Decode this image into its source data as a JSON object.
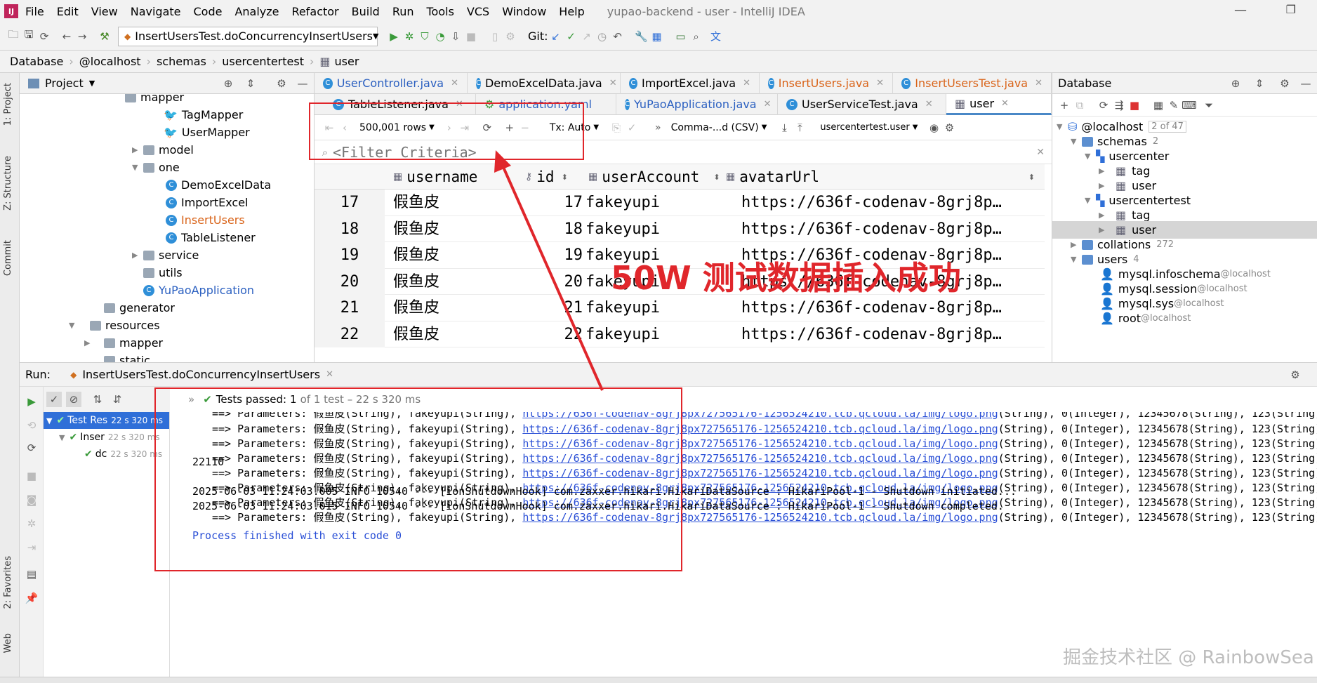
{
  "menubar": {
    "items": [
      "File",
      "Edit",
      "View",
      "Navigate",
      "Code",
      "Analyze",
      "Refactor",
      "Build",
      "Run",
      "Tools",
      "VCS",
      "Window",
      "Help"
    ],
    "title": "yupao-backend - user - IntelliJ IDEA"
  },
  "toolbar": {
    "run_config": "InsertUsersTest.doConcurrencyInsertUsers",
    "git_label": "Git:"
  },
  "breadcrumb": [
    "Database",
    "@localhost",
    "schemas",
    "usercentertest",
    "user"
  ],
  "left_strip": {
    "project": "1: Project",
    "structure": "Z: Structure",
    "commit": "Commit",
    "favorites": "2: Favorites",
    "web": "Web"
  },
  "project_panel": {
    "title": "Project",
    "items": [
      {
        "label": "mapper"
      },
      {
        "label": "TagMapper"
      },
      {
        "label": "UserMapper"
      },
      {
        "label": "model"
      },
      {
        "label": "one"
      },
      {
        "label": "DemoExcelData"
      },
      {
        "label": "ImportExcel"
      },
      {
        "label": "InsertUsers"
      },
      {
        "label": "TableListener"
      },
      {
        "label": "service"
      },
      {
        "label": "utils"
      },
      {
        "label": "YuPaoApplication"
      },
      {
        "label": "generator"
      },
      {
        "label": "resources"
      },
      {
        "label": "mapper"
      },
      {
        "label": "static"
      }
    ]
  },
  "editor_tabs_row1": [
    "UserController.java",
    "DemoExcelData.java",
    "ImportExcel.java",
    "InsertUsers.java",
    "InsertUsersTest.java"
  ],
  "editor_tabs_row2": [
    "TableListener.java",
    "application.yaml",
    "YuPaoApplication.java",
    "UserServiceTest.java",
    "user"
  ],
  "grid_toolbar": {
    "rows": "500,001 rows",
    "tx": "Tx: Auto",
    "export": "Comma-...d (CSV)",
    "schema": "usercentertest.user"
  },
  "filter": {
    "placeholder": "<Filter Criteria>"
  },
  "grid": {
    "columns": [
      "username",
      "id",
      "userAccount",
      "avatarUrl"
    ],
    "rows": [
      {
        "n": "17",
        "username": "假鱼皮",
        "id": "17",
        "account": "fakeyupi",
        "avatar": "https://636f-codenav-8grj8p…"
      },
      {
        "n": "18",
        "username": "假鱼皮",
        "id": "18",
        "account": "fakeyupi",
        "avatar": "https://636f-codenav-8grj8p…"
      },
      {
        "n": "19",
        "username": "假鱼皮",
        "id": "19",
        "account": "fakeyupi",
        "avatar": "https://636f-codenav-8grj8p…"
      },
      {
        "n": "20",
        "username": "假鱼皮",
        "id": "20",
        "account": "fakeyupi",
        "avatar": "https://636f-codenav-8grj8p…"
      },
      {
        "n": "21",
        "username": "假鱼皮",
        "id": "21",
        "account": "fakeyupi",
        "avatar": "https://636f-codenav-8grj8p…"
      },
      {
        "n": "22",
        "username": "假鱼皮",
        "id": "22",
        "account": "fakeyupi",
        "avatar": "https://636f-codenav-8grj8p…"
      }
    ]
  },
  "annotation": "50W 测试数据插入成功",
  "db_panel": {
    "title": "Database",
    "host": "@localhost",
    "host_count": "2 of 47",
    "schemas": "schemas",
    "schemas_count": "2",
    "usercenter": "usercenter",
    "tag1": "tag",
    "user1": "user",
    "usercentertest": "usercentertest",
    "tag2": "tag",
    "user2": "user",
    "collations": "collations",
    "collations_count": "272",
    "users": "users",
    "users_count": "4",
    "u1": "mysql.infoschema",
    "u2": "mysql.session",
    "u3": "mysql.sys",
    "u4": "root",
    "host_suffix": "@localhost"
  },
  "run_panel": {
    "label": "Run:",
    "tab": "InsertUsersTest.doConcurrencyInsertUsers",
    "status_prefix": "Tests passed:",
    "status_count": "1",
    "status_rest": "of 1 test – 22 s 320 ms",
    "tree": [
      {
        "label": "Test Res",
        "time": "22 s 320 ms"
      },
      {
        "label": "Inser",
        "time": "22 s 320 ms"
      },
      {
        "label": "dc",
        "time": "22 s 320 ms"
      }
    ],
    "param_prefix": "==> Parameters: 假鱼皮(String), fakeyupi(String),",
    "param_link": "https://636f-codenav-8grj8px727565176-1256524210.tcb.qcloud.la/img/logo.png",
    "param_suffix": "(String), 0(Integer), 12345678(String), 123(String)",
    "count_line": "22110",
    "log1": "2025-06-03 11:24:03.005  INFO 10540 --- [ionShutdownHook] com.zaxxer.hikari.HikariDataSource       : HikariPool-1 - Shutdown initiated...",
    "log2": "2025-06-03 11:24:03.015  INFO 10540 --- [ionShutdownHook] com.zaxxer.hikari.HikariDataSource       : HikariPool-1 - Shutdown completed.",
    "finish": "Process finished with exit code 0"
  },
  "watermark": "掘金技术社区 @ RainbowSea"
}
